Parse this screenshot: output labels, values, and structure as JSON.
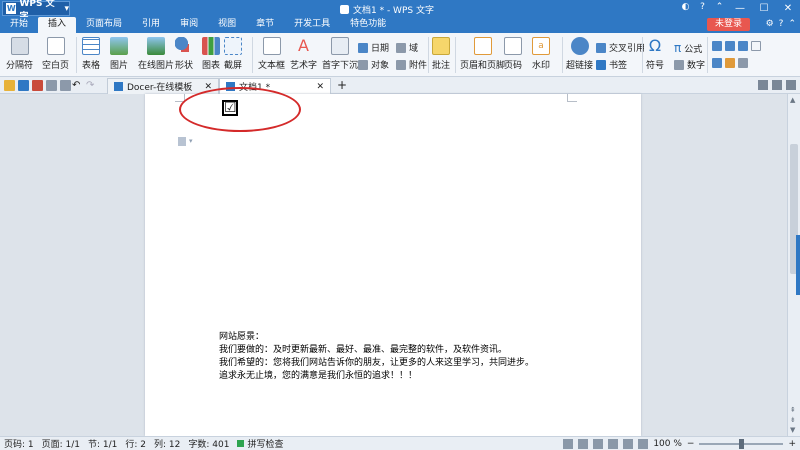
{
  "titlebar": {
    "app_name": "WPS 文字",
    "document_title": "文档1 * - WPS 文字",
    "login_label": "未登录"
  },
  "menu_tabs": [
    "开始",
    "插入",
    "页面布局",
    "引用",
    "审阅",
    "视图",
    "章节",
    "开发工具",
    "特色功能"
  ],
  "active_tab_index": 1,
  "ribbon": {
    "page_break": "分隔符",
    "blank_page": "空白页",
    "table": "表格",
    "picture": "图片",
    "online_picture": "在线图片",
    "shapes": "形状",
    "chart": "图表",
    "screenshot": "截屏",
    "textbox": "文本框",
    "wordart": "艺术字",
    "drop_cap": "首字下沉",
    "date": "日期",
    "field": "域",
    "object": "对象",
    "attachment": "附件",
    "comment": "批注",
    "header_footer": "页眉和页脚",
    "page_number": "页码",
    "watermark": "水印",
    "hyperlink": "超链接",
    "cross_ref": "交叉引用",
    "bookmark": "书签",
    "symbol": "符号",
    "formula": "公式",
    "number": "数字"
  },
  "doc_tabs": [
    {
      "label": "Docer-在线模板"
    },
    {
      "label": "文档1 *"
    }
  ],
  "document": {
    "checkbox_glyph": "☑",
    "lines": [
      "网站愿景：",
      "我们要做的：及时更新最新、最好、最准、最完整的软件，及软件资讯。",
      "我们希望的：您将我们网站告诉你的朋友，让更多的人来这里学习，共同进步。",
      "追求永无止境，您的满意是我们永恒的追求！！！"
    ]
  },
  "statusbar": {
    "page_num": "页码: 1",
    "page_count": "页面: 1/1",
    "section": "节: 1/1",
    "line": "行: 2",
    "column": "列: 12",
    "word_count": "字数: 401",
    "spell_check": "拼写检查",
    "zoom": "100 %"
  },
  "colors": {
    "accent": "#2f78c4",
    "login": "#e8574f",
    "annotation": "#d42a2a"
  }
}
